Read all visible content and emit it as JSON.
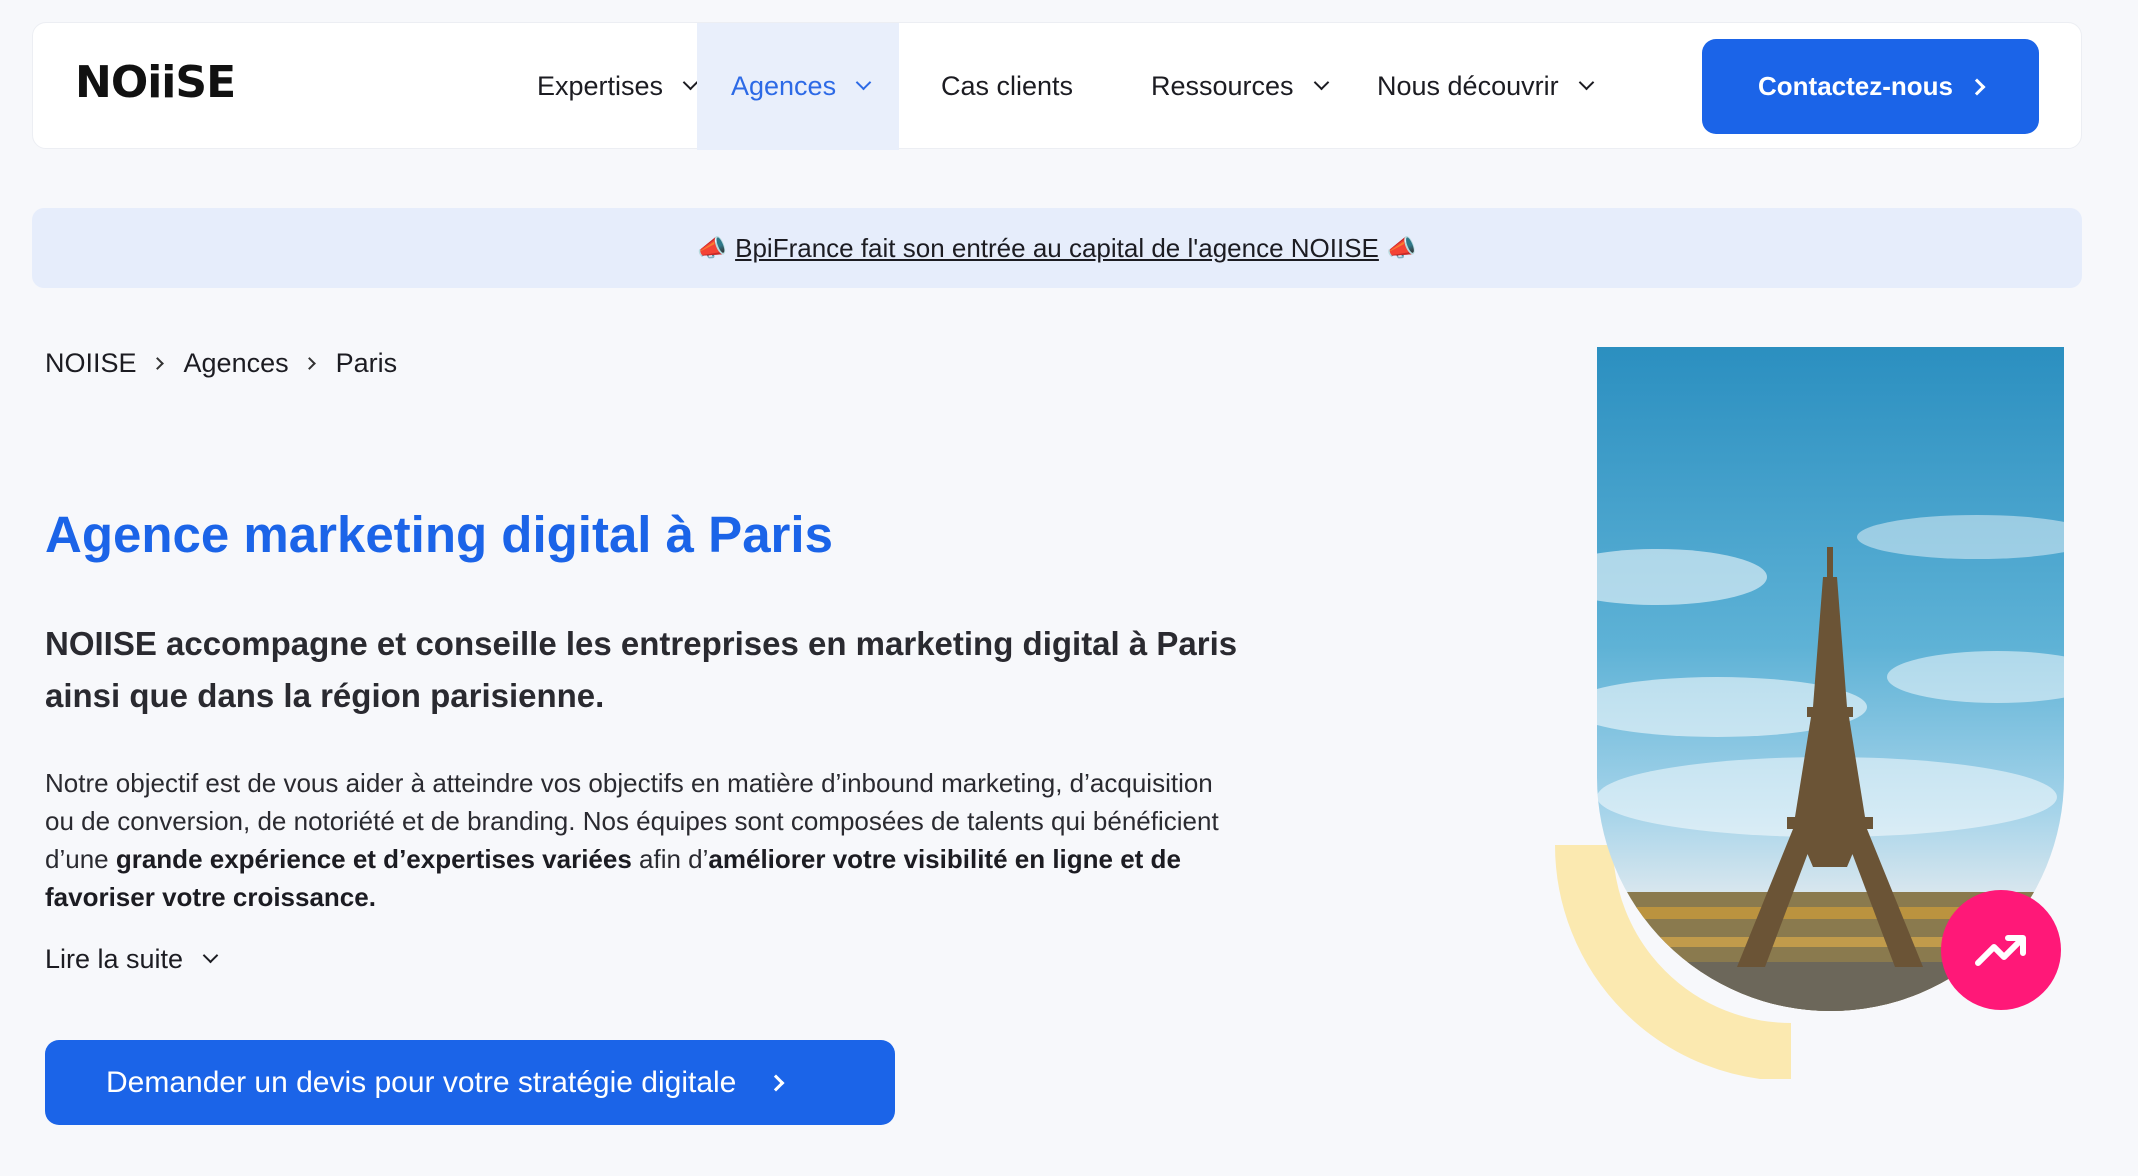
{
  "header": {
    "logo": "NOiiSE",
    "nav": [
      {
        "label": "Expertises",
        "has_dropdown": true,
        "active": false
      },
      {
        "label": "Agences",
        "has_dropdown": true,
        "active": true
      },
      {
        "label": "Cas clients",
        "has_dropdown": false,
        "active": false
      },
      {
        "label": "Ressources",
        "has_dropdown": true,
        "active": false
      },
      {
        "label": "Nous découvrir",
        "has_dropdown": true,
        "active": false
      }
    ],
    "cta_label": "Contactez-nous"
  },
  "banner": {
    "emoji": "📣",
    "text": "BpiFrance fait son entrée au capital de l'agence NOIISE"
  },
  "breadcrumb": [
    "NOIISE",
    "Agences",
    "Paris"
  ],
  "main": {
    "title": "Agence marketing digital à Paris",
    "lead": "NOIISE accompagne et conseille les entreprises en marketing digital à Paris ainsi que dans la région parisienne.",
    "body": {
      "part1": "Notre objectif est de vous aider à atteindre vos objectifs en matière d’inbound marketing, d’acquisition ou de conversion, de notoriété et de branding. Nos équipes sont composées de talents qui bénéficient d’une ",
      "bold1": "grande expérience et d’expertises variées",
      "part2": " afin d’",
      "bold2": "améliorer votre visibilité en ligne et de favoriser votre croissance."
    },
    "read_more": "Lire la suite",
    "cta_label": "Demander un devis pour votre stratégie digitale"
  },
  "colors": {
    "accent": "#1b64e8",
    "badge": "#ff1878",
    "arc": "#fbe9b0",
    "banner_bg": "#e6edfb"
  },
  "icons": {
    "hero_badge": "trending-up-icon"
  }
}
